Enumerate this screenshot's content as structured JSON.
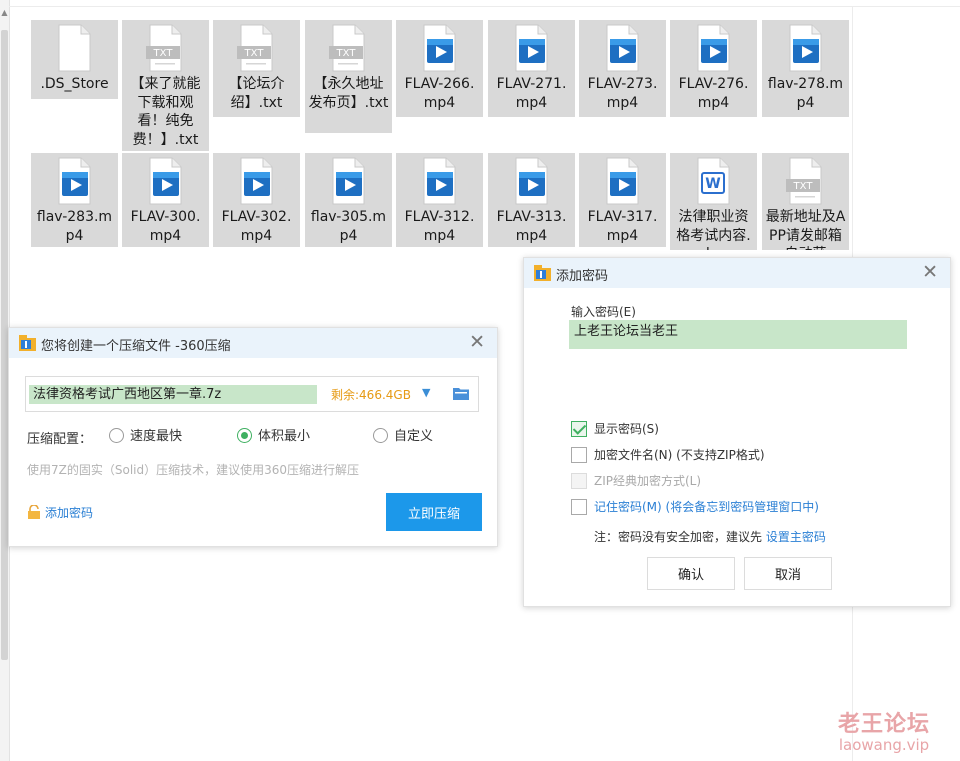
{
  "files": [
    {
      "name": ".DS_Store",
      "type": "blank"
    },
    {
      "name": "【来了就能下载和观看！纯免费！】.txt",
      "type": "txt"
    },
    {
      "name": "【论坛介绍】.txt",
      "type": "txt"
    },
    {
      "name": "【永久地址发布页】.txt",
      "type": "txt"
    },
    {
      "name": "FLAV-266.mp4",
      "type": "video"
    },
    {
      "name": "FLAV-271.mp4",
      "type": "video"
    },
    {
      "name": "FLAV-273.mp4",
      "type": "video"
    },
    {
      "name": "FLAV-276.mp4",
      "type": "video"
    },
    {
      "name": "flav-278.mp4",
      "type": "video"
    },
    {
      "name": "flav-283.mp4",
      "type": "video"
    },
    {
      "name": "FLAV-300.mp4",
      "type": "video"
    },
    {
      "name": "FLAV-302.mp4",
      "type": "video"
    },
    {
      "name": "flav-305.mp4",
      "type": "video"
    },
    {
      "name": "FLAV-312.mp4",
      "type": "video"
    },
    {
      "name": "FLAV-313.mp4",
      "type": "video"
    },
    {
      "name": "FLAV-317.mp4",
      "type": "video"
    },
    {
      "name": "法律职业资格考试内容.doc",
      "type": "doc"
    },
    {
      "name": "最新地址及APP请发邮箱自动获",
      "type": "txt"
    }
  ],
  "txt_badge": "TXT",
  "compress_dialog": {
    "title": "您将创建一个压缩文件 -360压缩",
    "close": "✕",
    "filename": "法律资格考试广西地区第一章.7z",
    "free_space": "剩余:466.4GB",
    "config_label": "压缩配置：",
    "options": [
      "速度最快",
      "体积最小",
      "自定义"
    ],
    "selected_option": "体积最小",
    "hint": "使用7Z的固实（Solid）压缩技术，建议使用360压缩进行解压",
    "add_password": "添加密码",
    "compress_button": "立即压缩"
  },
  "password_dialog": {
    "title": "添加密码",
    "close": "✕",
    "input_label": "输入密码(E)",
    "password_value": "上老王论坛当老王",
    "show_password": "显示密码(S)",
    "encrypt_filename": "加密文件名(N) (不支持ZIP格式)",
    "zip_classic": "ZIP经典加密方式(L)",
    "remember_password": "记住密码(M) (将会备忘到密码管理窗口中)",
    "note_prefix": "注：密码没有安全加密，建议先 ",
    "note_link": "设置主密码",
    "ok": "确认",
    "cancel": "取消"
  },
  "watermark": {
    "line1": "老王论坛",
    "line2": "laowang.vip"
  },
  "colors": {
    "accent": "#1c98ea",
    "highlight": "#c8e6c9",
    "free_space": "#e69a14",
    "link": "#2a7fd4",
    "tile_bg": "#d9d9d9"
  }
}
